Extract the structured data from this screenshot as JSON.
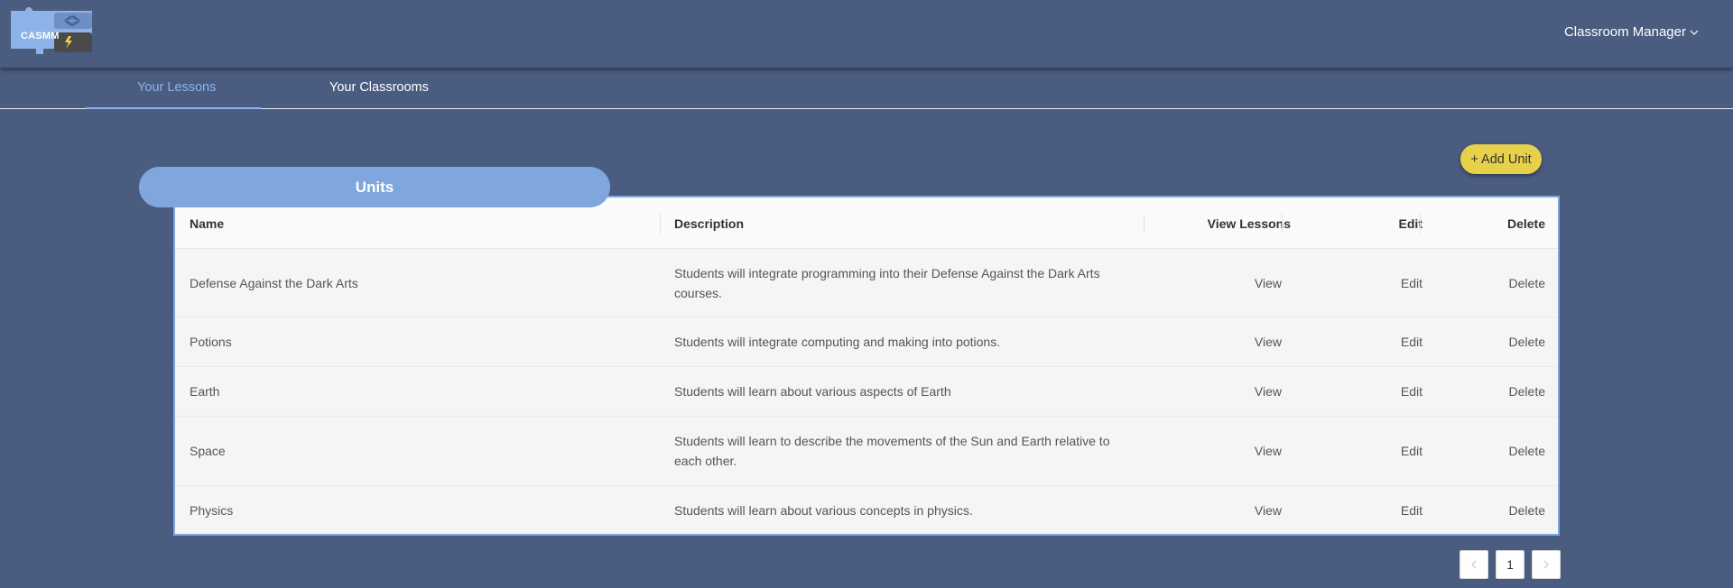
{
  "header": {
    "logo_text": "CASMM",
    "user_menu_label": "Classroom Manager"
  },
  "tabs": [
    {
      "label": "Your Lessons",
      "active": true
    },
    {
      "label": "Your Classrooms",
      "active": false
    }
  ],
  "add_unit_label": "+ Add Unit",
  "units_title": "Units",
  "table": {
    "columns": [
      "Name",
      "Description",
      "View Lessons",
      "Edit",
      "Delete"
    ],
    "rows": [
      {
        "name": "Defense Against the Dark Arts",
        "desc1": "Students will integrate programming into their Defense Against the Dark Arts",
        "desc2": "courses.",
        "view": "View",
        "edit": "Edit",
        "delete": "Delete"
      },
      {
        "name": "Potions",
        "desc1": "Students will integrate computing and making into potions.",
        "desc2": "",
        "view": "View",
        "edit": "Edit",
        "delete": "Delete"
      },
      {
        "name": "Earth",
        "desc1": "Students will learn about various aspects of Earth",
        "desc2": "",
        "view": "View",
        "edit": "Edit",
        "delete": "Delete"
      },
      {
        "name": "Space",
        "desc1": "Students will learn to describe the movements of the Sun and Earth relative to",
        "desc2": "each other.",
        "view": "View",
        "edit": "Edit",
        "delete": "Delete"
      },
      {
        "name": "Physics",
        "desc1": "Students will learn about various concepts in physics.",
        "desc2": "",
        "view": "View",
        "edit": "Edit",
        "delete": "Delete"
      }
    ]
  },
  "pagination": {
    "current_page": "1",
    "prev_icon": "chevron-left-icon",
    "next_icon": "chevron-right-icon"
  },
  "colors": {
    "background": "#4a5c80",
    "accent": "#7fa7dd",
    "active_tab": "#8db3e8",
    "add_button": "#e8d14a"
  }
}
